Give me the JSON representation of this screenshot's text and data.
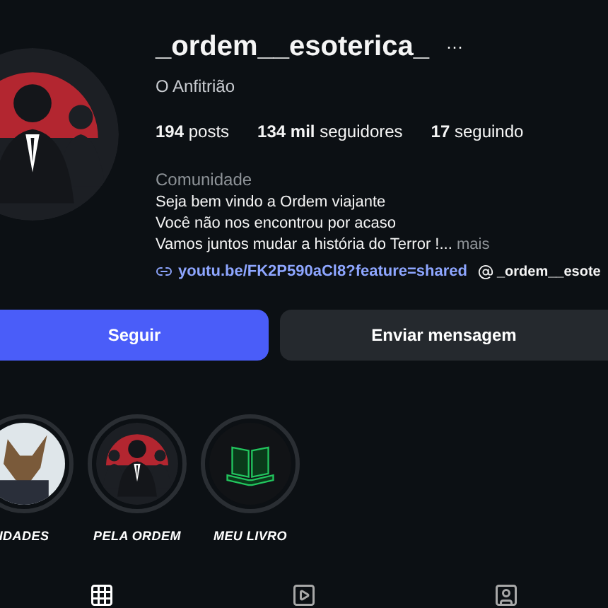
{
  "profile": {
    "username": "_ordem__esoterica_",
    "more": "···",
    "name": "O Anfitrião",
    "stats": [
      "**194** posts",
      "**134 mil** seguidores",
      "**17** seguindo"
    ],
    "category": "Comunidade",
    "bio": [
      "Seja bem vindo a Ordem viajante",
      "Você não nos encontrou por acaso",
      "Vamos juntos mudar a história do Terror !..."
    ],
    "more_link": "mais",
    "link": "youtu.be/FK2P590aCl8?feature=shared",
    "threads": "_ordem__esote"
  },
  "buttons": [
    {
      "label": "Seguir",
      "kind": "primary"
    },
    {
      "label": "Enviar mensagem",
      "kind": "secondary"
    }
  ],
  "highlights": [
    {
      "label": "IDADES",
      "kind": "picture"
    },
    {
      "label": "PELA ORDEM",
      "kind": "logo"
    },
    {
      "label": "MEU LIVRO",
      "kind": "book"
    }
  ],
  "tabs": [
    {
      "kind": "grid",
      "selected": true
    },
    {
      "kind": "reels",
      "selected": false
    },
    {
      "kind": "tagged",
      "selected": false
    }
  ]
}
